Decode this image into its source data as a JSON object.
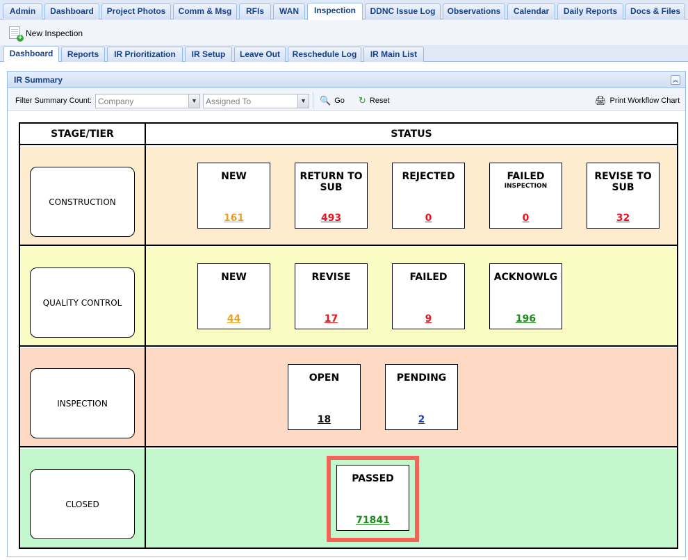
{
  "top_tabs": [
    {
      "label": "Admin"
    },
    {
      "label": "Dashboard"
    },
    {
      "label": "Project Photos"
    },
    {
      "label": "Comm & Msg"
    },
    {
      "label": "RFIs"
    },
    {
      "label": "WAN"
    },
    {
      "label": "Inspection"
    },
    {
      "label": "DDNC Issue Log"
    },
    {
      "label": "Observations"
    },
    {
      "label": "Calendar"
    },
    {
      "label": "Daily Reports"
    },
    {
      "label": "Docs & Files"
    }
  ],
  "active_top_tab": "Inspection",
  "toolbar": {
    "new_inspection": "New Inspection"
  },
  "sub_tabs": [
    {
      "label": "Dashboard"
    },
    {
      "label": "Reports"
    },
    {
      "label": "IR Prioritization"
    },
    {
      "label": "IR Setup"
    },
    {
      "label": "Leave Out"
    },
    {
      "label": "Reschedule Log"
    },
    {
      "label": "IR Main List"
    }
  ],
  "active_sub_tab": "Dashboard",
  "panel": {
    "title": "IR Summary"
  },
  "filter": {
    "label": "Filter Summary Count:",
    "company_placeholder": "Company",
    "assigned_placeholder": "Assigned To",
    "go_label": "Go",
    "reset_label": "Reset",
    "print_label": "Print Workflow Chart"
  },
  "workflow": {
    "header_stage": "STAGE/TIER",
    "header_status": "STATUS",
    "rows": [
      {
        "stage": "CONSTRUCTION",
        "bg": "#fdeccd",
        "boxes": [
          {
            "title": "NEW",
            "sub": "",
            "count": "161",
            "color": "#f0a020"
          },
          {
            "title": "RETURN TO SUB",
            "sub": "",
            "count": "493",
            "color": "#e8141e"
          },
          {
            "title": "REJECTED",
            "sub": "",
            "count": "0",
            "color": "#e8141e"
          },
          {
            "title": "FAILED",
            "sub": "INSPECTION",
            "count": "0",
            "color": "#e8141e"
          },
          {
            "title": "REVISE TO SUB",
            "sub": "",
            "count": "32",
            "color": "#e8141e"
          }
        ]
      },
      {
        "stage": "QUALITY CONTROL",
        "bg": "#fbfcc4",
        "boxes": [
          {
            "title": "NEW",
            "sub": "",
            "count": "44",
            "color": "#f0a020"
          },
          {
            "title": "REVISE",
            "sub": "",
            "count": "17",
            "color": "#e8141e"
          },
          {
            "title": "FAILED",
            "sub": "",
            "count": "9",
            "color": "#e8141e"
          },
          {
            "title": "ACKNOWLG",
            "sub": "",
            "count": "196",
            "color": "#1a8a1a"
          }
        ]
      },
      {
        "stage": "INSPECTION",
        "bg": "#fed9c3",
        "boxes": [
          {
            "title": "OPEN",
            "sub": "",
            "count": "18",
            "color": "#111111"
          },
          {
            "title": "PENDING",
            "sub": "",
            "count": "2",
            "color": "#1a3fb0"
          }
        ]
      },
      {
        "stage": "CLOSED",
        "bg": "#c2f8cc",
        "boxes": [
          {
            "title": "PASSED",
            "sub": "",
            "count": "71841",
            "color": "#1a8a1a"
          }
        ]
      }
    ]
  }
}
